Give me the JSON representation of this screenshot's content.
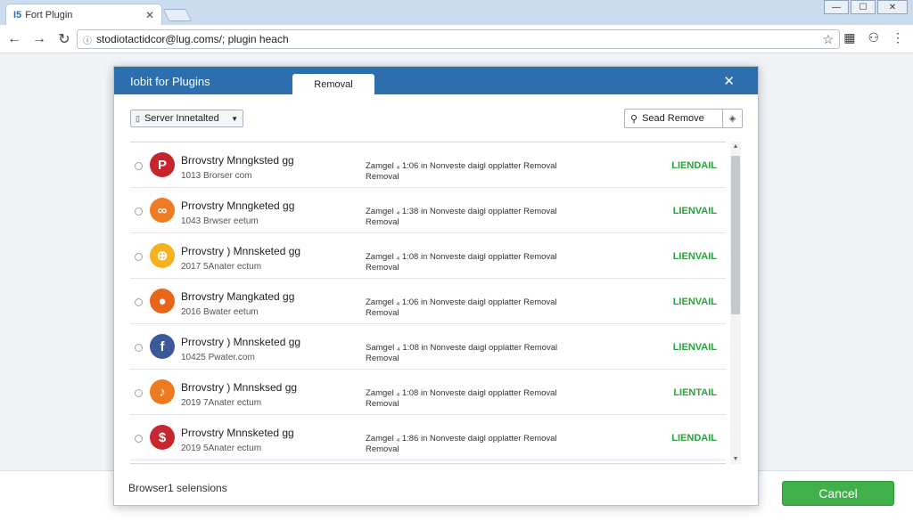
{
  "browser": {
    "tab_favicon": "I5",
    "tab_title": "Fort Plugin",
    "url": "stodiotactidcor@lug.coms/; plugin heach",
    "window_controls": [
      "minimize",
      "maximize",
      "close"
    ]
  },
  "dialog": {
    "title": "Iobit for Plugins",
    "active_tab": "Removal",
    "filter_selected": "Server Innetalted",
    "search_placeholder": "Sead Remove",
    "footer_label": "Browser1 selensions",
    "plugins": [
      {
        "name": "Brrovstry Mnngksted gg",
        "sub": "1013 Brorser com",
        "desc_line1": "Zamgel ₄ 1:06 in Nonveste daigl opplatter Removal",
        "desc_line2": "Removal",
        "status": "LIENDAIL",
        "icon": "pinterest-icon",
        "color": "#c8232c",
        "glyph": "P"
      },
      {
        "name": "Prrovstry Mnngketed gg",
        "sub": "1043 Brwser eetum",
        "desc_line1": "Zamgel ₄ 1:38 in Nonveste daigl opplatter Removal",
        "desc_line2": "Removal",
        "status": "LIENVAIL",
        "icon": "link-icon",
        "color": "#ef7b23",
        "glyph": "∞"
      },
      {
        "name": "Prrovstry ) Mnnsketed gg",
        "sub": "2017 5Anater ectum",
        "desc_line1": "Zamgel ₄ 1:08 in Nonveste daigl opplatter Removal",
        "desc_line2": "Removal",
        "status": "LIENVAIL",
        "icon": "chain-icon",
        "color": "#f4b21f",
        "glyph": "⊕"
      },
      {
        "name": "Brrovstry Mangkated gg",
        "sub": "2016 Bwater eetum",
        "desc_line1": "Zamgel ₄ 1:06 in Nonveste daigl opplatter Removal",
        "desc_line2": "Removal",
        "status": "LIENVAIL",
        "icon": "firefox-icon",
        "color": "#e8661b",
        "glyph": "●"
      },
      {
        "name": "Prrovstry ) Mnnsketed gg",
        "sub": "10425 Pwater.com",
        "desc_line1": "Samgel ₄ 1:08 in Nonveste daigl opplatter Removal",
        "desc_line2": "Removal",
        "status": "LIENVAIL",
        "icon": "facebook-icon",
        "color": "#3b5998",
        "glyph": "f"
      },
      {
        "name": "Brrovstry ) Mnnsksed gg",
        "sub": "2019 7Anater ectum",
        "desc_line1": "Zamgel ₄ 1:08 in Nonveste daigl opplatter Removal",
        "desc_line2": "Removal",
        "status": "LIENTAIL",
        "icon": "music-note-icon",
        "color": "#ee7a1f",
        "glyph": "♪"
      },
      {
        "name": "Prrovstry Mnnsketed gg",
        "sub": "2019 5Anater ectum",
        "desc_line1": "Zamgel ₄ 1:86 in Nonveste daigl opplatter Removal",
        "desc_line2": "Removal",
        "status": "LIENDAIL",
        "icon": "dollar-icon",
        "color": "#c7282f",
        "glyph": "$"
      }
    ]
  },
  "page": {
    "cancel_label": "Cancel"
  }
}
